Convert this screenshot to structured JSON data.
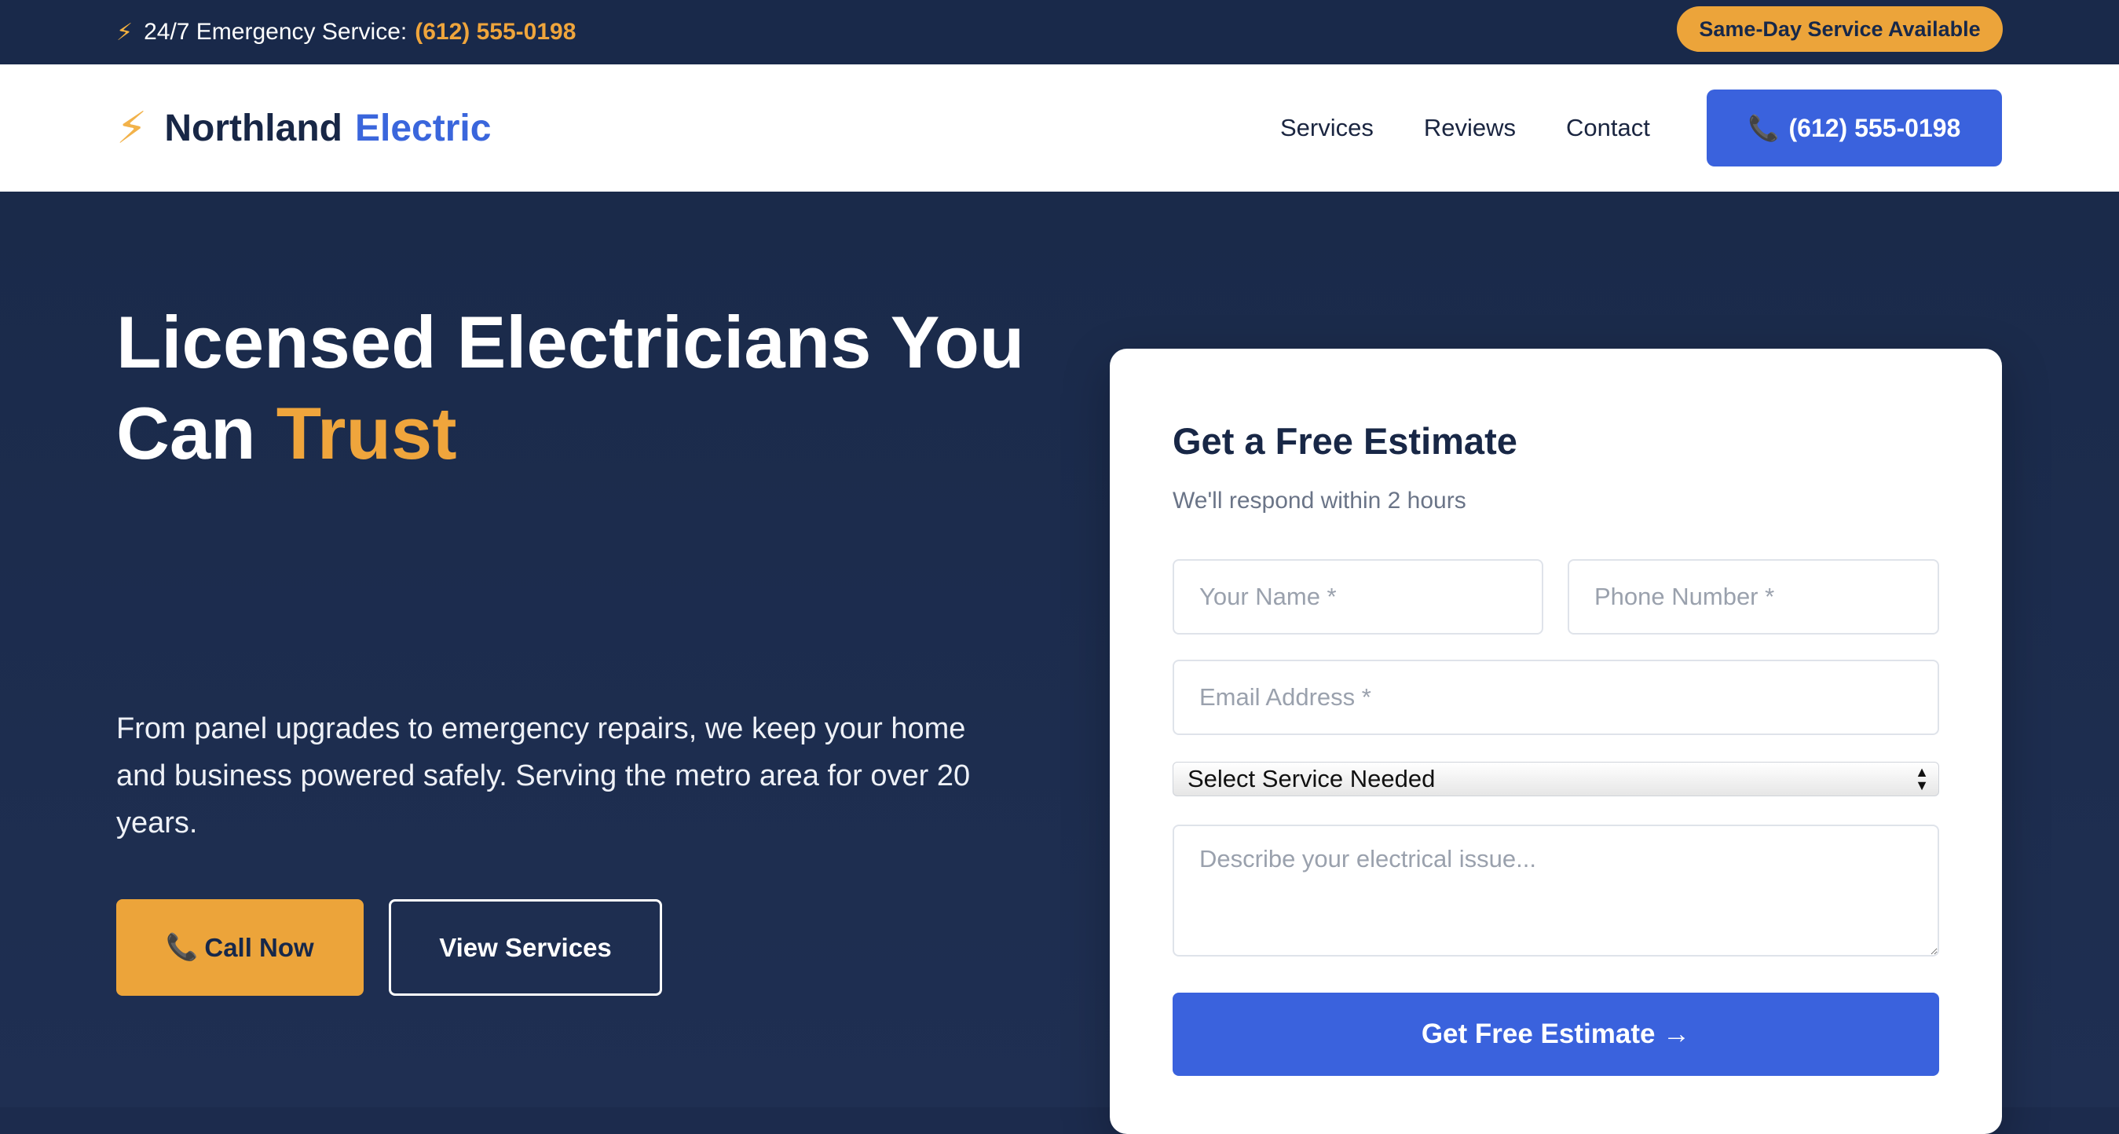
{
  "topbar": {
    "bolt_icon": "⚡",
    "emergency_label": "24/7 Emergency Service:",
    "emergency_phone": "(612) 555-0198",
    "badge": "Same-Day Service Available"
  },
  "nav": {
    "logo_icon": "⚡",
    "brand_part1": "Northland",
    "brand_part2": "Electric",
    "links": [
      "Services",
      "Reviews",
      "Contact"
    ],
    "phone_icon": "📞",
    "phone_button": "(612) 555-0198"
  },
  "hero": {
    "title_part1": "Licensed Electricians You Can ",
    "title_accent": "Trust",
    "subtitle": "From panel upgrades to emergency repairs, we keep your home and business powered safely. Serving the metro area for over 20 years.",
    "call_icon": "📞",
    "call_label": "Call Now",
    "services_label": "View Services"
  },
  "form": {
    "title": "Get a Free Estimate",
    "subtitle": "We'll respond within 2 hours",
    "name_placeholder": "Your Name *",
    "phone_placeholder": "Phone Number *",
    "email_placeholder": "Email Address *",
    "service_select": "Select Service Needed",
    "description_placeholder": "Describe your electrical issue...",
    "submit_label": "Get Free Estimate →"
  },
  "colors": {
    "navy": "#19294a",
    "accent_orange": "#eca43a",
    "brand_blue": "#3a62dd",
    "white": "#ffffff"
  }
}
